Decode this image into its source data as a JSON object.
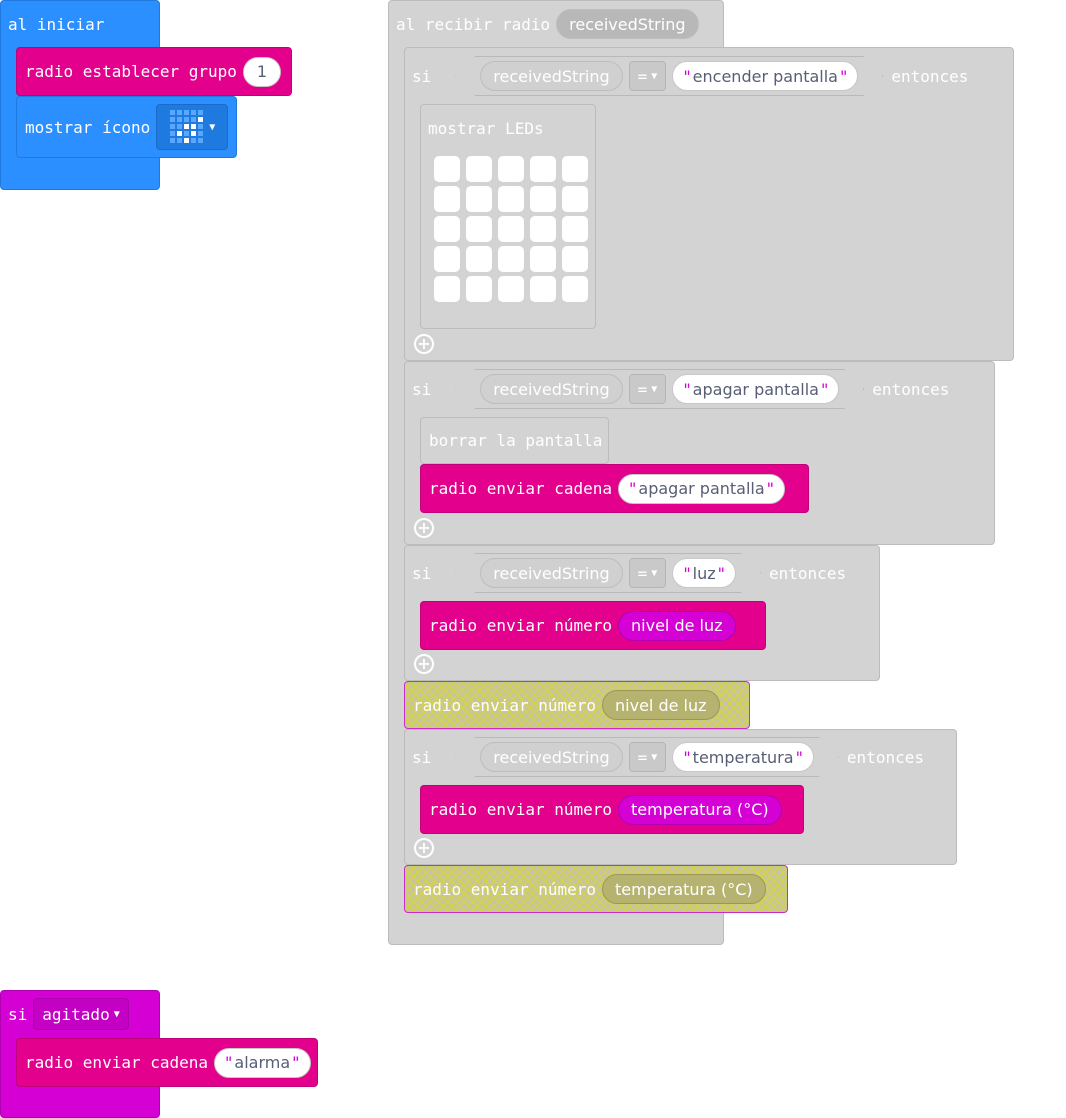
{
  "colors": {
    "basic": "#2b8fff",
    "radio": "#e3008c",
    "input": "#d400d4",
    "logic_gray": "#d3d3d3",
    "disabled": "#c7c4a2"
  },
  "on_start": {
    "header": "al iniciar",
    "set_group": {
      "label": "radio establecer grupo",
      "value": "1"
    },
    "show_icon": {
      "label": "mostrar ícono",
      "icon": "diagonal-dots-icon"
    }
  },
  "on_received": {
    "header": "al recibir radio",
    "param": "receivedString",
    "if_word": "si",
    "then_word": "entonces",
    "eq_symbol": "=",
    "conditions": [
      {
        "variable": "receivedString",
        "value": "encender pantalla"
      },
      {
        "variable": "receivedString",
        "value": "apagar pantalla"
      },
      {
        "variable": "receivedString",
        "value": "luz"
      },
      {
        "variable": "receivedString",
        "value": "temperatura"
      }
    ],
    "show_leds_label": "mostrar LEDs",
    "clear_screen_label": "borrar la pantalla",
    "send_string": {
      "label": "radio enviar cadena",
      "value": "apagar pantalla"
    },
    "send_light": {
      "label": "radio enviar número",
      "value": "nivel de luz"
    },
    "send_light_disabled": {
      "label": "radio enviar número",
      "value": "nivel de luz"
    },
    "send_temp": {
      "label": "radio enviar número",
      "value": "temperatura (°C)"
    },
    "send_temp_disabled": {
      "label": "radio enviar número",
      "value": "temperatura (°C)"
    }
  },
  "on_gesture": {
    "if_word": "si",
    "gesture": "agitado",
    "send_string": {
      "label": "radio enviar cadena",
      "value": "alarma"
    }
  }
}
